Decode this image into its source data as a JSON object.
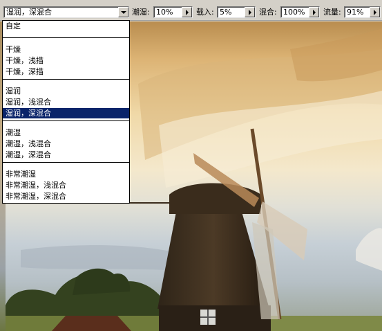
{
  "toolbar": {
    "preset_value": "湿润，深混合",
    "wet_label": "潮湿:",
    "wet_value": "10%",
    "load_label": "载入:",
    "load_value": "5%",
    "mix_label": "混合:",
    "mix_value": "100%",
    "flow_label": "流量:",
    "flow_value": "91%"
  },
  "dropdown": {
    "groups": [
      [
        "自定"
      ],
      [
        "干燥",
        "干燥，浅描",
        "干燥，深描"
      ],
      [
        "湿润",
        "湿润，浅混合",
        "湿润，深混合"
      ],
      [
        "潮湿",
        "潮湿，浅混合",
        "潮湿，深混合"
      ],
      [
        "非常潮湿",
        "非常潮湿，浅混合",
        "非常潮湿，深混合"
      ]
    ],
    "selected": "湿润，深混合"
  },
  "icons": {
    "dropdown_arrow": "chevron-down-icon",
    "slider_arrow": "chevron-right-icon"
  },
  "colors": {
    "selection": "#0a246a"
  }
}
